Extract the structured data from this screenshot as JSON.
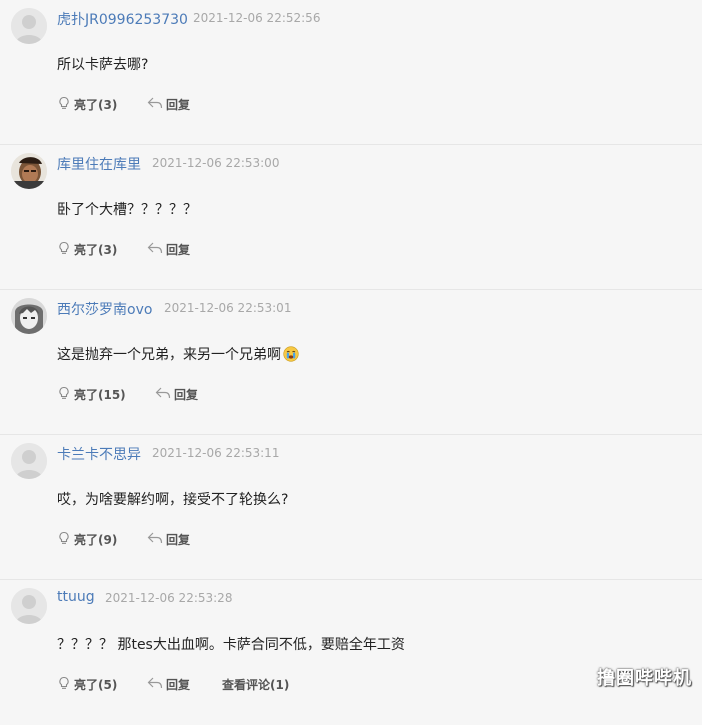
{
  "comments": [
    {
      "username": "虎扑JR0996253730",
      "time": "2021-12-06 22:52:56",
      "content": "所以卡萨去哪?",
      "like_label": "亮了(3)",
      "reply_label": "回复",
      "avatar": "default-avatar"
    },
    {
      "username": "库里住在库里",
      "time": "2021-12-06 22:53:00",
      "content": "卧了个大槽？？？？？",
      "like_label": "亮了(3)",
      "reply_label": "回复",
      "avatar": "photo-avatar-face"
    },
    {
      "username": "西尔莎罗南ovo",
      "time": "2021-12-06 22:53:01",
      "content": "这是抛弃一个兄弟，来另一个兄弟啊",
      "emoji": "crying-emoji",
      "like_label": "亮了(15)",
      "reply_label": "回复",
      "avatar": "photo-avatar-anime"
    },
    {
      "username": "卡兰卡不思异",
      "time": "2021-12-06 22:53:11",
      "content": "哎，为啥要解约啊，接受不了轮换么?",
      "like_label": "亮了(9)",
      "reply_label": "回复",
      "avatar": "default-avatar"
    },
    {
      "username": "ttuug",
      "time": "2021-12-06 22:53:28",
      "content": "？？？？ 那tes大出血啊。卡萨合同不低，要赔全年工资",
      "like_label": "亮了(5)",
      "reply_label": "回复",
      "view_comments_label": "查看评论(1)",
      "avatar": "default-avatar"
    }
  ],
  "watermark": "撸圈哔哔机",
  "colors": {
    "username": "#4c7bb8",
    "timestamp": "#a8a8a8",
    "background": "#f6f6f6",
    "divider": "#e6e6e6"
  }
}
